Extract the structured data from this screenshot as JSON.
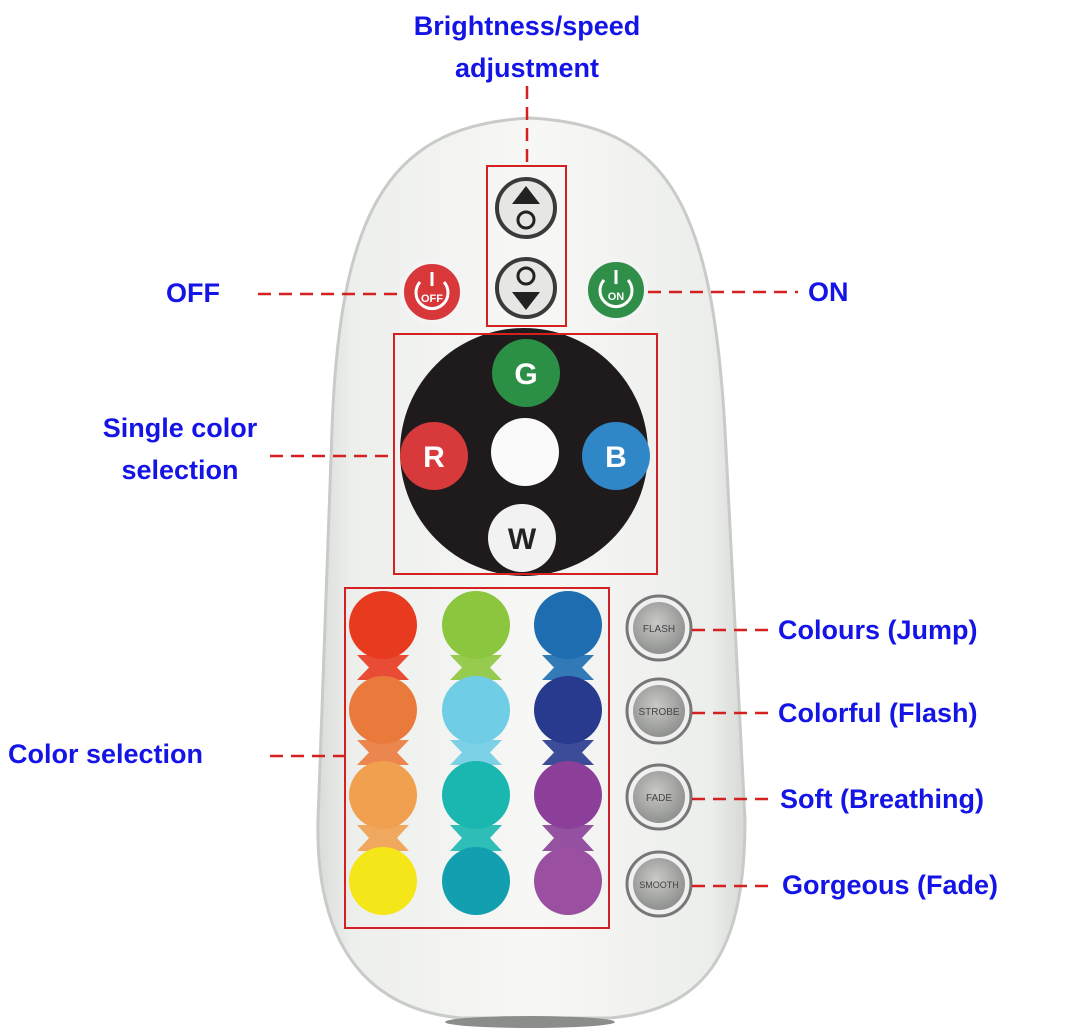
{
  "labels": {
    "brightness_line1": "Brightness/speed",
    "brightness_line2": "adjustment",
    "off": "OFF",
    "on": "ON",
    "single_line1": "Single color",
    "single_line2": "selection",
    "color_selection": "Color selection",
    "jump": "Colours (Jump)",
    "flash": "Colorful (Flash)",
    "breathing": "Soft (Breathing)",
    "fade": "Gorgeous (Fade)"
  },
  "buttons": {
    "off_text": "OFF",
    "on_text": "ON",
    "g": "G",
    "r": "R",
    "b": "B",
    "w": "W",
    "flash": "FLASH",
    "strobe": "STROBE",
    "fade": "FADE",
    "smooth": "SMOOTH"
  },
  "colors": {
    "label": "#1414e6",
    "annotation_line": "#d42020",
    "off_button": "#d8383a",
    "on_button": "#2f8f48",
    "g_button": "#2b8f45",
    "r_button": "#d83a3c",
    "b_button": "#2f87c8",
    "grid": [
      [
        "#e83a1f",
        "#8cc63e",
        "#1d6db0"
      ],
      [
        "#ea7a3c",
        "#6fcde6",
        "#283a8e"
      ],
      [
        "#f0a04e",
        "#1ab7b0",
        "#8b3f98"
      ],
      [
        "#f5e61a",
        "#12a0b0",
        "#9b4fa0"
      ]
    ]
  }
}
